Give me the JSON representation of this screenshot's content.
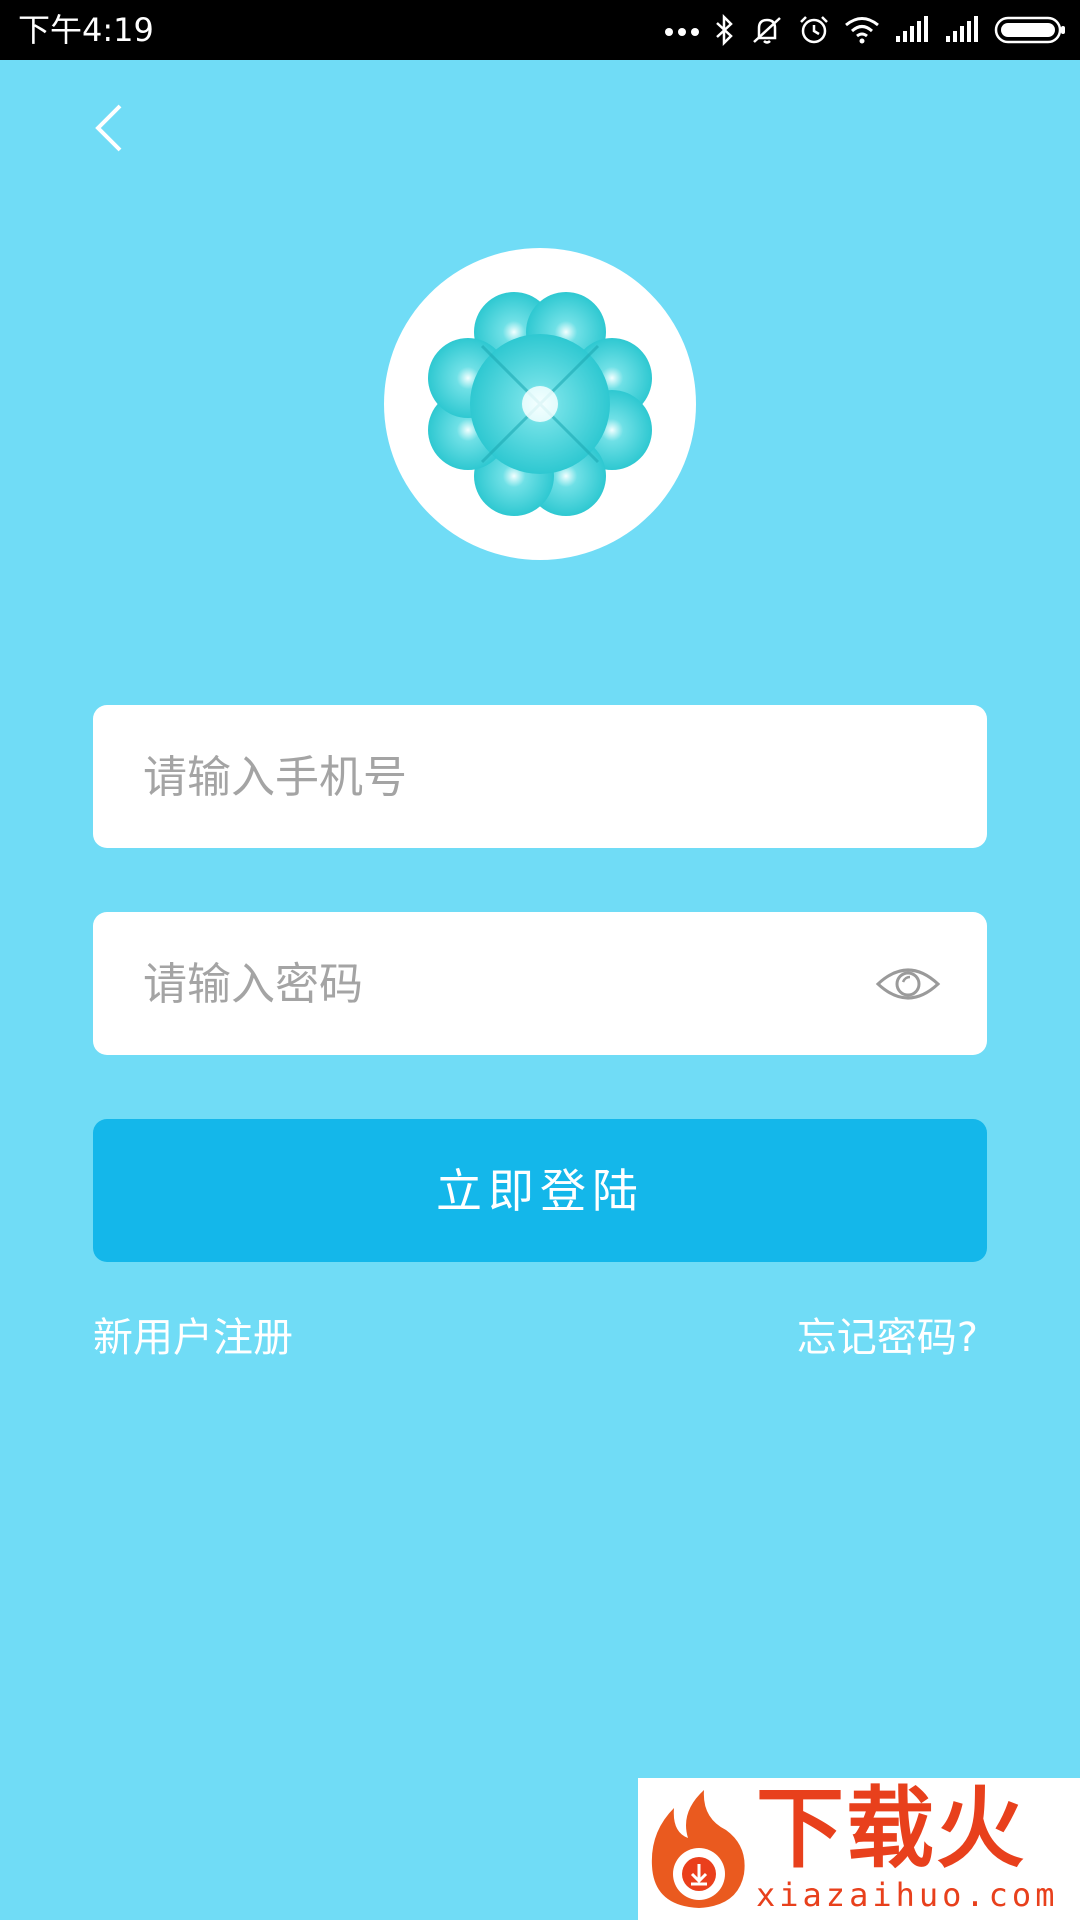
{
  "status_bar": {
    "time": "下午4:19",
    "icons": [
      "more-dots-icon",
      "bluetooth-icon",
      "silent-icon",
      "alarm-icon",
      "wifi-icon",
      "signal-icon",
      "signal-icon",
      "battery-icon"
    ]
  },
  "nav": {
    "back_icon": "chevron-left-icon"
  },
  "logo": {
    "icon": "clover-icon"
  },
  "form": {
    "phone_placeholder": "请输入手机号",
    "password_placeholder": "请输入密码",
    "password_toggle_icon": "eye-icon",
    "login_label": "立即登陆"
  },
  "links": {
    "register": "新用户注册",
    "forgot": "忘记密码?"
  },
  "watermark": {
    "brand": "下载火",
    "site": "xiazaihuo.com"
  },
  "colors": {
    "background": "#70dcf6",
    "button": "#14b7ea",
    "field": "#ffffff",
    "placeholder": "#a4a4a4"
  }
}
